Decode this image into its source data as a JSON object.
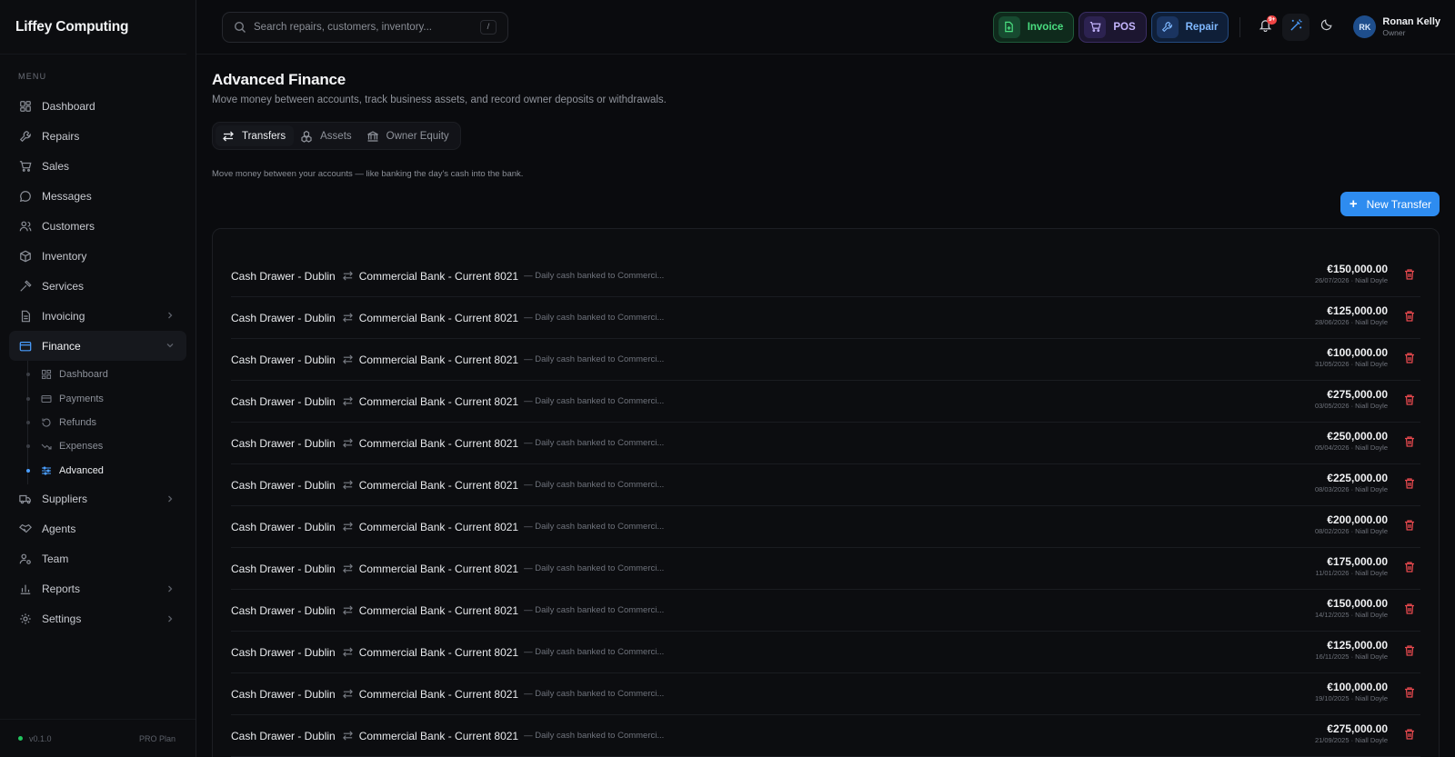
{
  "app": {
    "name": "Liffey Computing"
  },
  "sidebar": {
    "menu_label": "MENU",
    "items": [
      {
        "label": "Dashboard",
        "icon": "dashboard-icon"
      },
      {
        "label": "Repairs",
        "icon": "wrench-icon"
      },
      {
        "label": "Sales",
        "icon": "cart-icon"
      },
      {
        "label": "Messages",
        "icon": "chat-icon"
      },
      {
        "label": "Customers",
        "icon": "users-icon"
      },
      {
        "label": "Inventory",
        "icon": "box-icon"
      },
      {
        "label": "Services",
        "icon": "hammer-icon"
      },
      {
        "label": "Invoicing",
        "icon": "file-icon"
      },
      {
        "label": "Finance",
        "icon": "wallet-icon"
      },
      {
        "label": "Suppliers",
        "icon": "truck-icon"
      },
      {
        "label": "Agents",
        "icon": "handshake-icon"
      },
      {
        "label": "Team",
        "icon": "user-cog-icon"
      },
      {
        "label": "Reports",
        "icon": "bar-chart-icon"
      },
      {
        "label": "Settings",
        "icon": "gear-icon"
      }
    ],
    "finance_sub": [
      {
        "label": "Dashboard"
      },
      {
        "label": "Payments"
      },
      {
        "label": "Refunds"
      },
      {
        "label": "Expenses"
      },
      {
        "label": "Advanced"
      }
    ],
    "version": "v0.1.0",
    "plan": "PRO Plan"
  },
  "topbar": {
    "search_placeholder": "Search repairs, customers, inventory...",
    "search_shortcut": "/",
    "invoice_label": "Invoice",
    "pos_label": "POS",
    "repair_label": "Repair",
    "notification_badge": "9+",
    "user_initials": "RK",
    "user_name": "Ronan Kelly",
    "user_role": "Owner"
  },
  "page": {
    "title": "Advanced Finance",
    "subtitle": "Move money between accounts, track business assets, and record owner deposits or withdrawals.",
    "tabs": [
      "Transfers",
      "Assets",
      "Owner Equity"
    ],
    "tab_description": "Move money between your accounts — like banking the day's cash into the bank.",
    "new_transfer_label": "New Transfer"
  },
  "transfers": [
    {
      "from": "Cash Drawer - Dublin",
      "to": "Commercial Bank - Current 8021",
      "note": "— Daily cash banked to Commerci...",
      "amount": "€150,000.00",
      "meta": "26/07/2026 · Niall Doyle"
    },
    {
      "from": "Cash Drawer - Dublin",
      "to": "Commercial Bank - Current 8021",
      "note": "— Daily cash banked to Commerci...",
      "amount": "€125,000.00",
      "meta": "28/06/2026 · Niall Doyle"
    },
    {
      "from": "Cash Drawer - Dublin",
      "to": "Commercial Bank - Current 8021",
      "note": "— Daily cash banked to Commerci...",
      "amount": "€100,000.00",
      "meta": "31/05/2026 · Niall Doyle"
    },
    {
      "from": "Cash Drawer - Dublin",
      "to": "Commercial Bank - Current 8021",
      "note": "— Daily cash banked to Commerci...",
      "amount": "€275,000.00",
      "meta": "03/05/2026 · Niall Doyle"
    },
    {
      "from": "Cash Drawer - Dublin",
      "to": "Commercial Bank - Current 8021",
      "note": "— Daily cash banked to Commerci...",
      "amount": "€250,000.00",
      "meta": "05/04/2026 · Niall Doyle"
    },
    {
      "from": "Cash Drawer - Dublin",
      "to": "Commercial Bank - Current 8021",
      "note": "— Daily cash banked to Commerci...",
      "amount": "€225,000.00",
      "meta": "08/03/2026 · Niall Doyle"
    },
    {
      "from": "Cash Drawer - Dublin",
      "to": "Commercial Bank - Current 8021",
      "note": "— Daily cash banked to Commerci...",
      "amount": "€200,000.00",
      "meta": "08/02/2026 · Niall Doyle"
    },
    {
      "from": "Cash Drawer - Dublin",
      "to": "Commercial Bank - Current 8021",
      "note": "— Daily cash banked to Commerci...",
      "amount": "€175,000.00",
      "meta": "11/01/2026 · Niall Doyle"
    },
    {
      "from": "Cash Drawer - Dublin",
      "to": "Commercial Bank - Current 8021",
      "note": "— Daily cash banked to Commerci...",
      "amount": "€150,000.00",
      "meta": "14/12/2025 · Niall Doyle"
    },
    {
      "from": "Cash Drawer - Dublin",
      "to": "Commercial Bank - Current 8021",
      "note": "— Daily cash banked to Commerci...",
      "amount": "€125,000.00",
      "meta": "16/11/2025 · Niall Doyle"
    },
    {
      "from": "Cash Drawer - Dublin",
      "to": "Commercial Bank - Current 8021",
      "note": "— Daily cash banked to Commerci...",
      "amount": "€100,000.00",
      "meta": "19/10/2025 · Niall Doyle"
    },
    {
      "from": "Cash Drawer - Dublin",
      "to": "Commercial Bank - Current 8021",
      "note": "— Daily cash banked to Commerci...",
      "amount": "€275,000.00",
      "meta": "21/09/2025 · Niall Doyle"
    }
  ],
  "colors": {
    "accent": "#2e8cf0",
    "danger": "#e5484d",
    "success": "#22c55e"
  }
}
